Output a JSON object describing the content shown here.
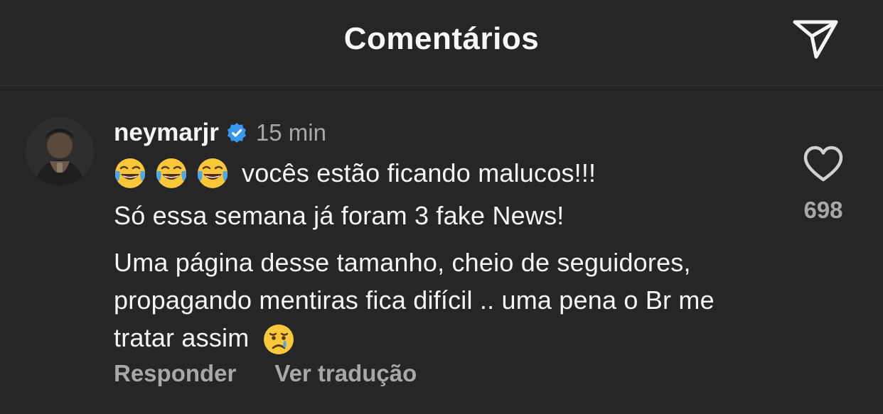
{
  "header": {
    "title": "Comentários"
  },
  "comment": {
    "username": "neymarjr",
    "verified": true,
    "timestamp": "15 min",
    "line1_text": "vocês estão ficando malucos!!!",
    "line2_text": "Só essa semana já foram 3 fake News!",
    "line3_text": "Uma página desse tamanho, cheio de seguidores, propagando mentiras fica difícil .. uma pena o Br me tratar assim",
    "likes": "698",
    "reply_label": "Responder",
    "translate_label": "Ver tradução"
  },
  "icons": {
    "share": "send-icon",
    "like": "heart-outline-icon",
    "verified": "verified-badge-icon",
    "emoji_laugh": "tears-of-joy-emoji",
    "emoji_cry": "crying-face-emoji"
  },
  "colors": {
    "background": "#262626",
    "text": "#f5f5f5",
    "secondary": "#a8a8a8",
    "verified": "#3897f0"
  }
}
